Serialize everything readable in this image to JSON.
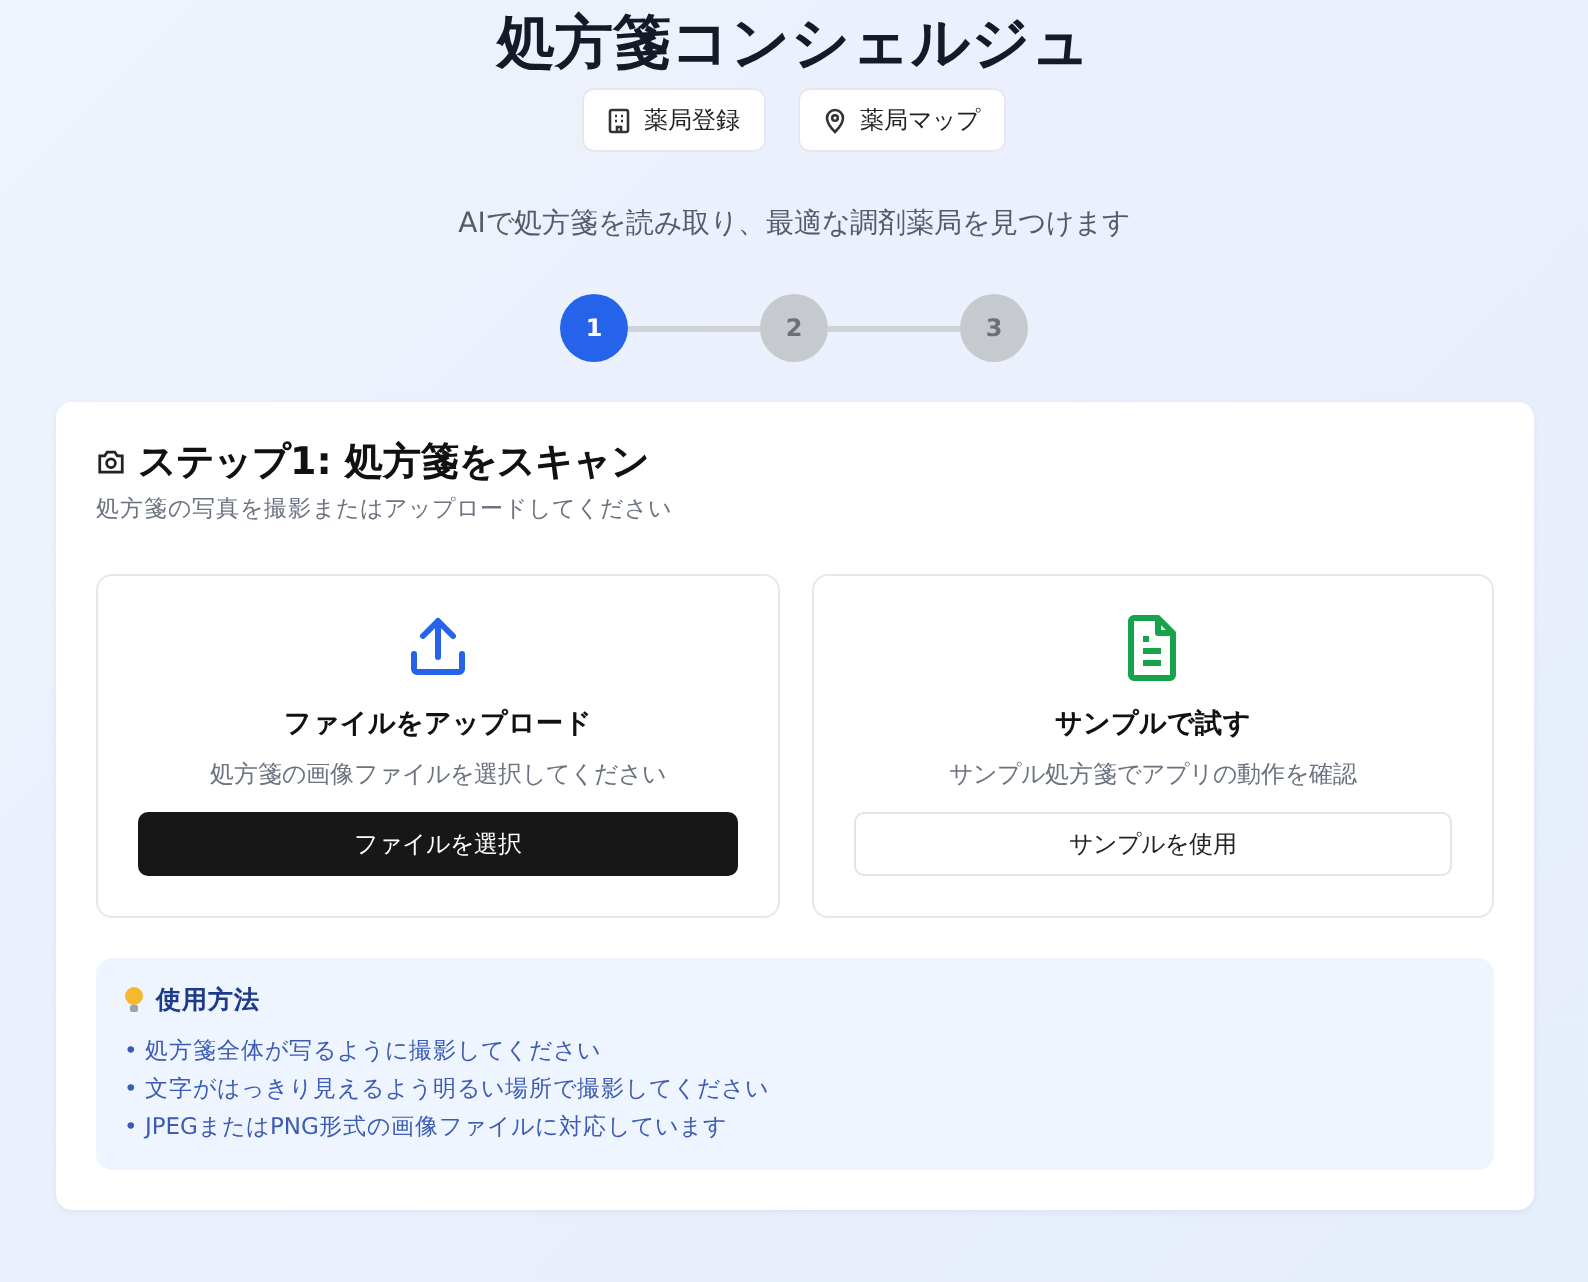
{
  "title": "処方箋コンシェルジュ",
  "nav_buttons": [
    {
      "label": "薬局登録",
      "kind": "building"
    },
    {
      "label": "薬局マップ",
      "kind": "pin"
    }
  ],
  "subtitle": "AIで処方箋を読み取り、最適な調剤薬局を見つけます",
  "steps": [
    {
      "label": "1",
      "selected": true
    },
    {
      "label": "2",
      "selected": false
    },
    {
      "label": "3",
      "selected": false
    }
  ],
  "card": {
    "title": "ステップ1: 処方箋をスキャン",
    "description": "処方箋の写真を撮影またはアップロードしてください",
    "options": [
      {
        "kind": "upload",
        "title": "ファイルをアップロード",
        "description": "処方箋の画像ファイルを選択してください",
        "button": "ファイルを選択"
      },
      {
        "kind": "sample",
        "title": "サンプルで試す",
        "description": "サンプル処方箋でアプリの動作を確認",
        "button": "サンプルを使用"
      }
    ],
    "tips": {
      "title": "使用方法",
      "items": [
        "• 処方箋全体が写るように撮影してください",
        "• 文字がはっきり見えるよう明るい場所で撮影してください",
        "• JPEGまたはPNG形式の画像ファイルに対応しています"
      ]
    }
  }
}
